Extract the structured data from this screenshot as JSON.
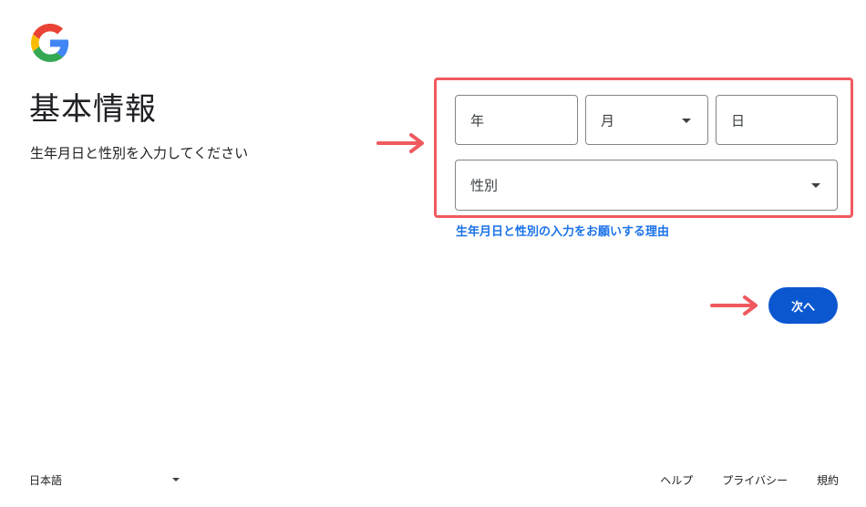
{
  "header": {
    "title": "基本情報",
    "subtitle": "生年月日と性別を入力してください"
  },
  "form": {
    "year_placeholder": "年",
    "month_placeholder": "月",
    "day_placeholder": "日",
    "gender_placeholder": "性別",
    "reason_link": "生年月日と性別の入力をお願いする理由"
  },
  "actions": {
    "next_label": "次へ"
  },
  "footer": {
    "language": "日本語",
    "help": "ヘルプ",
    "privacy": "プライバシー",
    "terms": "規約"
  },
  "colors": {
    "accent": "#0b57d0",
    "link": "#1a73e8",
    "annotation": "#ef5a5f",
    "field_border": "#80868b"
  },
  "icons": {
    "logo": "google-logo-icon",
    "annotation_arrow": "right-arrow-icon",
    "dropdown": "caret-down-icon"
  }
}
